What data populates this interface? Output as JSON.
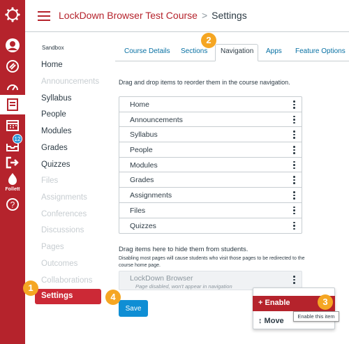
{
  "header": {
    "course": "LockDown Browser Test Course",
    "separator": ">",
    "current": "Settings"
  },
  "global_nav": {
    "badge_count": "12",
    "follett_label": "Follett"
  },
  "course_nav": {
    "sandbox": "Sandbox",
    "items": [
      {
        "label": "Home"
      },
      {
        "label": "Announcements"
      },
      {
        "label": "Syllabus"
      },
      {
        "label": "People"
      },
      {
        "label": "Modules"
      },
      {
        "label": "Grades"
      },
      {
        "label": "Quizzes"
      },
      {
        "label": "Files"
      },
      {
        "label": "Assignments"
      },
      {
        "label": "Conferences"
      },
      {
        "label": "Discussions"
      },
      {
        "label": "Pages"
      },
      {
        "label": "Outcomes"
      },
      {
        "label": "Collaborations"
      },
      {
        "label": "Settings"
      }
    ]
  },
  "tabs": [
    "Course Details",
    "Sections",
    "Navigation",
    "Apps",
    "Feature Options"
  ],
  "instructions": "Drag and drop items to reorder them in the course navigation.",
  "nav_list": [
    "Home",
    "Announcements",
    "Syllabus",
    "People",
    "Modules",
    "Grades",
    "Assignments",
    "Files",
    "Quizzes"
  ],
  "hidden_section": {
    "heading": "Drag items here to hide them from students.",
    "note": "Disabling most pages will cause students who visit those pages to be redirected to the course home page.",
    "item_title": "LockDown Browser",
    "item_subtitle": "Page disabled, won't appear in navigation"
  },
  "save_label": "Save",
  "menu": {
    "enable": "+ Enable",
    "move": "↕ Move",
    "tooltip": "Enable this item"
  },
  "callouts": [
    "1",
    "2",
    "3",
    "4"
  ],
  "colors": {
    "brand": "#b5232c",
    "link": "#0770a3",
    "save": "#0f8ed4",
    "callout": "#f5a623"
  }
}
